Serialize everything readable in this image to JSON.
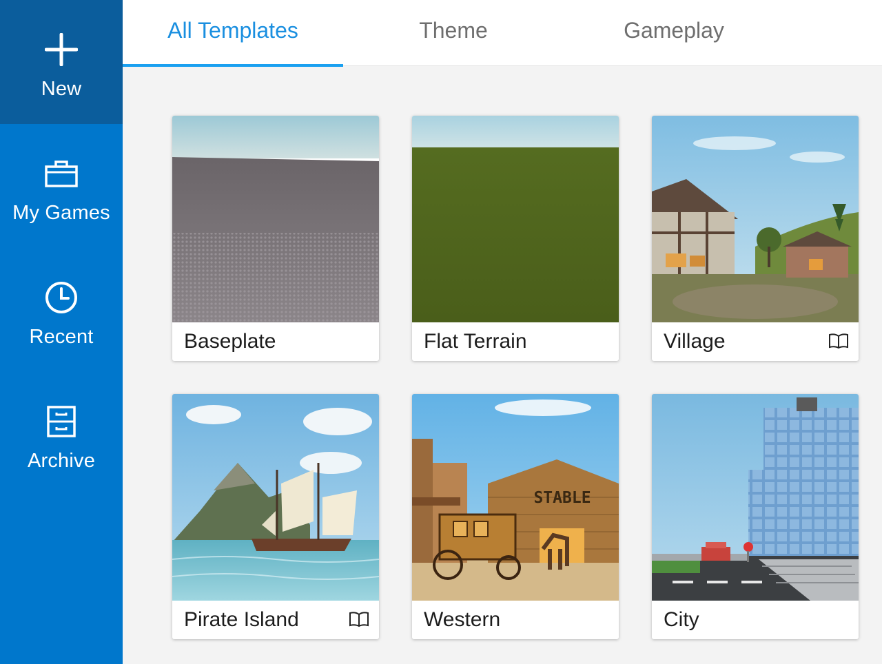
{
  "sidebar": {
    "items": [
      {
        "label": "New",
        "icon": "plus-icon"
      },
      {
        "label": "My Games",
        "icon": "briefcase-icon"
      },
      {
        "label": "Recent",
        "icon": "clock-icon"
      },
      {
        "label": "Archive",
        "icon": "archive-icon"
      }
    ]
  },
  "tabs": [
    {
      "label": "All Templates",
      "active": true
    },
    {
      "label": "Theme",
      "active": false
    },
    {
      "label": "Gameplay",
      "active": false
    }
  ],
  "templates": [
    {
      "name": "Baseplate",
      "has_tutorial": false
    },
    {
      "name": "Flat Terrain",
      "has_tutorial": false
    },
    {
      "name": "Village",
      "has_tutorial": true
    },
    {
      "name": "Pirate Island",
      "has_tutorial": true
    },
    {
      "name": "Western",
      "has_tutorial": false,
      "sign": "STABLE"
    },
    {
      "name": "City",
      "has_tutorial": false
    }
  ],
  "colors": {
    "sidebar": "#0077cc",
    "sidebar_active": "#0b5d9c",
    "tab_active": "#1a8fe0",
    "tab_inactive": "#6e6e6e"
  }
}
